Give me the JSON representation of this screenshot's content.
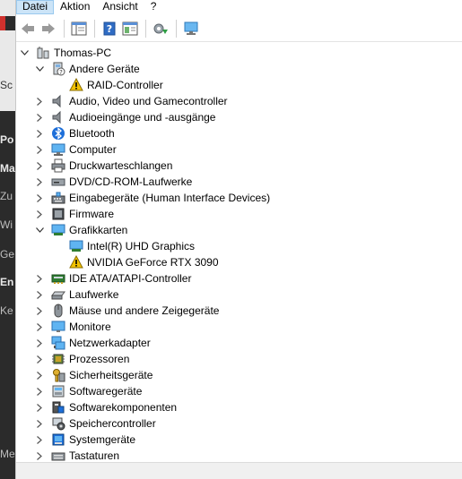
{
  "menubar": {
    "items": [
      "Datei",
      "Aktion",
      "Ansicht",
      "?"
    ]
  },
  "background": {
    "fragments": [
      "Sc",
      "Po",
      "Ma",
      "Zu",
      "Wi",
      "Ge",
      "En",
      "Ke",
      "Me"
    ]
  },
  "tree": {
    "root": "Thomas-PC",
    "rows": [
      {
        "label": "Andere Geräte",
        "icon": "unknown-device-icon",
        "expanded": true
      },
      {
        "label": "RAID-Controller",
        "icon": "warning-device-icon",
        "child": true
      },
      {
        "label": "Audio, Video und Gamecontroller",
        "icon": "speaker-icon"
      },
      {
        "label": "Audioeingänge und -ausgänge",
        "icon": "speaker-icon"
      },
      {
        "label": "Bluetooth",
        "icon": "bluetooth-icon"
      },
      {
        "label": "Computer",
        "icon": "computer-icon"
      },
      {
        "label": "Druckwarteschlangen",
        "icon": "printer-icon"
      },
      {
        "label": "DVD/CD-ROM-Laufwerke",
        "icon": "dvd-drive-icon"
      },
      {
        "label": "Eingabegeräte (Human Interface Devices)",
        "icon": "hid-icon"
      },
      {
        "label": "Firmware",
        "icon": "firmware-icon"
      },
      {
        "label": "Grafikkarten",
        "icon": "display-adapter-icon",
        "expanded": true
      },
      {
        "label": "Intel(R) UHD Graphics",
        "icon": "display-adapter-icon",
        "child": true
      },
      {
        "label": "NVIDIA GeForce RTX 3090",
        "icon": "warning-device-icon",
        "child": true
      },
      {
        "label": "IDE ATA/ATAPI-Controller",
        "icon": "ide-controller-icon"
      },
      {
        "label": "Laufwerke",
        "icon": "disk-drive-icon"
      },
      {
        "label": "Mäuse und andere Zeigegeräte",
        "icon": "mouse-icon"
      },
      {
        "label": "Monitore",
        "icon": "monitor-icon"
      },
      {
        "label": "Netzwerkadapter",
        "icon": "network-adapter-icon"
      },
      {
        "label": "Prozessoren",
        "icon": "processor-icon"
      },
      {
        "label": "Sicherheitsgeräte",
        "icon": "security-device-icon"
      },
      {
        "label": "Softwaregeräte",
        "icon": "software-device-icon"
      },
      {
        "label": "Softwarekomponenten",
        "icon": "software-component-icon"
      },
      {
        "label": "Speichercontroller",
        "icon": "storage-controller-icon"
      },
      {
        "label": "Systemgeräte",
        "icon": "system-device-icon"
      },
      {
        "label": "Tastaturen",
        "icon": "keyboard-icon"
      }
    ]
  },
  "colors": {
    "menu_active": "#cce4f7",
    "warning": "#f2c200",
    "accent_blue": "#1e88e5"
  }
}
